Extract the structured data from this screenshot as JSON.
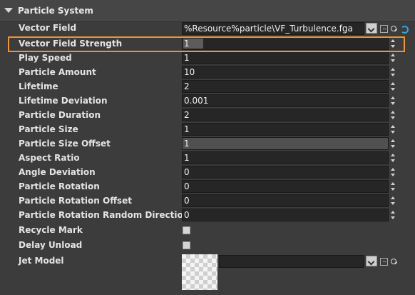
{
  "panel": {
    "title": "Particle System"
  },
  "vector_field": {
    "label": "Vector Field",
    "value": "%Resource%particle\\VF_Turbulence.fga"
  },
  "rows": [
    {
      "label": "Vector Field Strength",
      "value": "1"
    },
    {
      "label": "Play Speed",
      "value": "1"
    },
    {
      "label": "Particle Amount",
      "value": "10"
    },
    {
      "label": "Lifetime",
      "value": "2"
    },
    {
      "label": "Lifetime Deviation",
      "value": "0.001"
    },
    {
      "label": "Particle Duration",
      "value": "2"
    },
    {
      "label": "Particle Size",
      "value": "1"
    },
    {
      "label": "Particle Size Offset",
      "value": "1"
    },
    {
      "label": "Aspect Ratio",
      "value": "1"
    },
    {
      "label": "Angle Deviation",
      "value": "0"
    },
    {
      "label": "Particle Rotation",
      "value": "0"
    },
    {
      "label": "Particle Rotation Offset",
      "value": "0"
    },
    {
      "label": "Particle Rotation Random Direction",
      "value": "0"
    }
  ],
  "checkboxes": [
    {
      "label": "Recycle Mark",
      "checked": false
    },
    {
      "label": "Delay Unload",
      "checked": false
    }
  ],
  "jet_model": {
    "label": "Jet Model",
    "value": ""
  },
  "colors": {
    "highlight": "#f0952e",
    "reset_icon": "#2ea6e0",
    "background": "#3c3c3c"
  }
}
